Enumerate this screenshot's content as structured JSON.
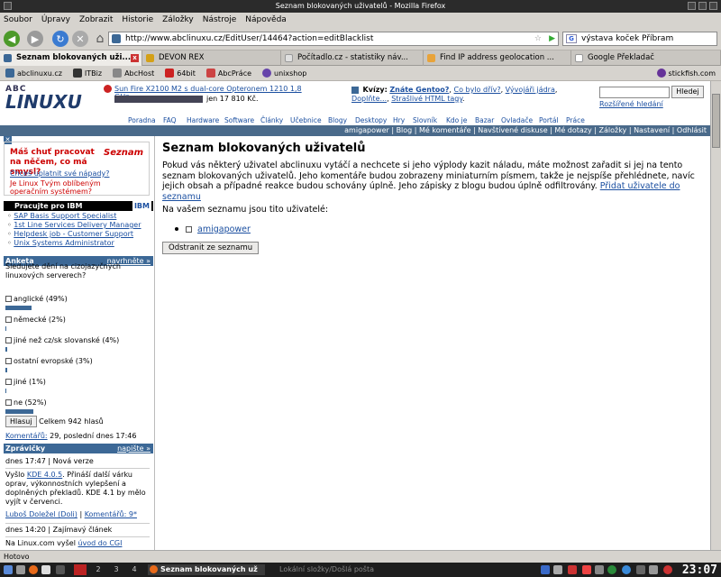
{
  "window": {
    "title": "Seznam blokovaných uživatelů - Mozilla Firefox"
  },
  "menu": [
    "Soubor",
    "Úpravy",
    "Zobrazit",
    "Historie",
    "Záložky",
    "Nástroje",
    "Nápověda"
  ],
  "toolbar": {
    "url": "http://www.abclinuxu.cz/EditUser/14464?action=editBlacklist",
    "search_value": "výstava koček Příbram"
  },
  "tabs": [
    {
      "label": "Seznam blokovaných uži...",
      "active": true,
      "color": "#3c6896"
    },
    {
      "label": "DEVON REX",
      "active": false,
      "color": "#d4a017"
    },
    {
      "label": "Počítadlo.cz - statistiky náv...",
      "active": false,
      "color": "#e0e0e0"
    },
    {
      "label": "Find IP address geolocation ...",
      "active": false,
      "color": "#e8a33a"
    },
    {
      "label": "Google Překladač",
      "active": false,
      "color": "#ffffff"
    }
  ],
  "bookmarks": [
    {
      "label": "abclinuxu.cz",
      "color": "#3c6896"
    },
    {
      "label": "ITBiz",
      "color": "#333333"
    },
    {
      "label": "AbcHost",
      "color": "#888888"
    },
    {
      "label": "64bit",
      "color": "#cc2222"
    },
    {
      "label": "AbcPráce",
      "color": "#cc4444"
    },
    {
      "label": "unixshop",
      "color": "#6644aa"
    }
  ],
  "bookmarks_right": "stickfish.com",
  "site": {
    "logo_top": "ABC",
    "logo_main": "LINUXU",
    "ad_link": "Sun Fire X2100 M2 s dual-core Opteronem 1210 1,8 GHz",
    "ad_price": "jen 17 810 Kč.",
    "kvizy_label": "Kvízy:",
    "kvizy_links": [
      "Znáte Gentoo?",
      "Co bylo dřív?",
      "Vývojáři jádra",
      "Doplňte...",
      "Strašlivé HTML tagy"
    ],
    "search_button": "Hledej",
    "advanced_search": "Rozšířené hledání",
    "nav": [
      "Poradna",
      "FAQ",
      "Hardware",
      "Software",
      "Články",
      "Učebnice",
      "Blogy",
      "Desktopy",
      "Hry",
      "Slovník",
      "Kdo je",
      "Bazar",
      "Ovladače",
      "Portál",
      "Práce"
    ],
    "usernav": "amigapower | Blog | Mé komentáře | Navštívené diskuse | Mé dotazy | Záložky | Nastavení | Odhlásit"
  },
  "promo": {
    "headline": "Máš chuť pracovat na něčem, co má smysl?",
    "link": "Chceš uplatnit své nápady?",
    "sub": "Je Linux Tvým oblíbeným operačním systémem?",
    "logo": "Seznam"
  },
  "ibm": {
    "header": "Pracujte pro IBM",
    "jobs": [
      "SAP Basis Support Specialist",
      "1st Line Services Delivery Manager",
      "Helpdesk job - Customer Support",
      "Unix Systems Administrator"
    ]
  },
  "poll": {
    "header": "Anketa",
    "header_link": "navrhněte »",
    "question": "Sledujete dění na cizojazyčných linuxových serverech?",
    "options": [
      {
        "label": "anglické (49%)",
        "percent": 49
      },
      {
        "label": "německé (2%)",
        "percent": 2
      },
      {
        "label": "jiné než cz/sk slovanské (4%)",
        "percent": 4
      },
      {
        "label": "ostatní evropské (3%)",
        "percent": 3
      },
      {
        "label": "jiné (1%)",
        "percent": 1
      },
      {
        "label": "ne (52%)",
        "percent": 52
      }
    ],
    "vote_button": "Hlasuj",
    "total": "Celkem 942 hlasů",
    "comments_link": "Komentářů:",
    "comments_info": "29, poslední dnes 17:46"
  },
  "news": {
    "header": "Zprávičky",
    "header_link": "napište »",
    "item1_meta": "dnes 17:47 | Nová verze",
    "item1_pre": "Vyšlo ",
    "item1_link": "KDE 4.0.5",
    "item1_text": ". Přináší další várku oprav, výkonnostních vylepšení a doplněných překladů. KDE 4.1 by mělo vyjít v červenci.",
    "item1_author": "Luboš Doležel (Doli)",
    "item1_comments": "Komentářů: 9*",
    "item2_meta": "dnes 14:20 | Zajímavý článek",
    "item2_text": "Na Linux.com vyšel ",
    "item2_link": "úvod do CGI"
  },
  "main": {
    "title": "Seznam blokovaných uživatelů",
    "description": "Pokud vás některý uživatel abclinuxu vytáčí a nechcete si jeho výplody kazit náladu, máte možnost zařadit si jej na tento seznam blokovaných uživatelů. Jeho komentáře budou zobrazeny miniaturním písmem, takže je nejspíše přehlédnete, navíc jejich obsah a případné reakce budou schovány úplně. Jeho zápisky z blogu budou úplně odfiltrovány.",
    "add_link": "Přidat uživatele do seznamu",
    "list_intro": "Na vašem seznamu jsou tito uživatelé:",
    "blocked_users": [
      "amigapower"
    ],
    "remove_button": "Odstranit ze seznamu"
  },
  "statusbar": "Hotovo",
  "taskbar": {
    "workspaces": [
      "2",
      "3",
      "4"
    ],
    "tasks": [
      "Seznam blokovaných už",
      "Lokální složky/Došlá pošta"
    ],
    "clock": "23:07"
  }
}
